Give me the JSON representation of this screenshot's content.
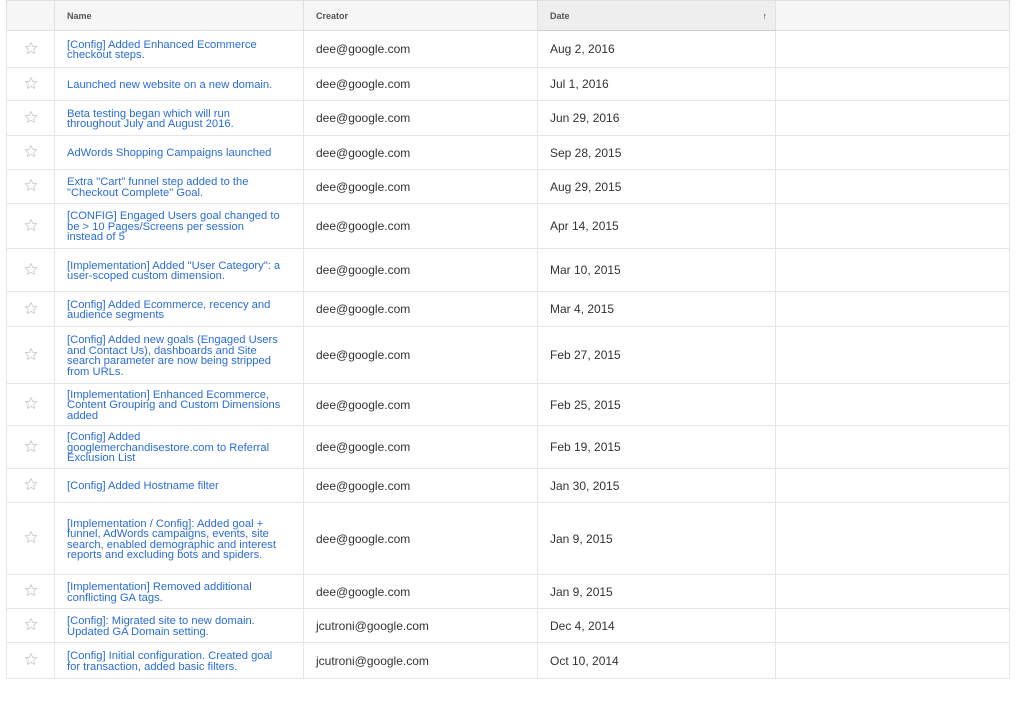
{
  "header": {
    "name_label": "Name",
    "creator_label": "Creator",
    "date_label": "Date",
    "sort_arrow": "↑"
  },
  "rows": [
    {
      "name": "[Config] Added Enhanced Ecommerce checkout steps.",
      "creator": "dee@google.com",
      "date": "Aug 2, 2016"
    },
    {
      "name": "Launched new website on a new domain.",
      "creator": "dee@google.com",
      "date": "Jul 1, 2016"
    },
    {
      "name": "Beta testing began which will run throughout July and August 2016.",
      "creator": "dee@google.com",
      "date": "Jun 29, 2016"
    },
    {
      "name": "AdWords Shopping Campaigns launched",
      "creator": "dee@google.com",
      "date": "Sep 28, 2015"
    },
    {
      "name": "Extra \"Cart\" funnel step added to the \"Checkout Complete\" Goal.",
      "creator": "dee@google.com",
      "date": "Aug 29, 2015"
    },
    {
      "name": "[CONFIG] Engaged Users goal changed to be > 10 Pages/Screens per session instead of 5",
      "creator": "dee@google.com",
      "date": "Apr 14, 2015"
    },
    {
      "name": "[Implementation] Added \"User Category\": a user-scoped custom dimension.",
      "creator": "dee@google.com",
      "date": "Mar 10, 2015"
    },
    {
      "name": "[Config] Added Ecommerce, recency and audience segments",
      "creator": "dee@google.com",
      "date": "Mar 4, 2015"
    },
    {
      "name": "[Config] Added new goals (Engaged Users and Contact Us), dashboards and Site search parameter are now being stripped from URLs.",
      "creator": "dee@google.com",
      "date": "Feb 27, 2015"
    },
    {
      "name": "[Implementation] Enhanced Ecommerce, Content Grouping and Custom Dimensions added",
      "creator": "dee@google.com",
      "date": "Feb 25, 2015"
    },
    {
      "name": "[Config] Added googlemerchandisestore.com to Referral Exclusion List",
      "creator": "dee@google.com",
      "date": "Feb 19, 2015"
    },
    {
      "name": "[Config] Added Hostname filter",
      "creator": "dee@google.com",
      "date": "Jan 30, 2015"
    },
    {
      "name": "[Implementation / Config]: Added goal + funnel, AdWords campaigns, events, site search, enabled demographic and interest reports and excluding bots and spiders.",
      "creator": "dee@google.com",
      "date": "Jan 9, 2015"
    },
    {
      "name": "[Implementation] Removed additional conflicting GA tags.",
      "creator": "dee@google.com",
      "date": "Jan 9, 2015"
    },
    {
      "name": "[Config]: Migrated site to new domain. Updated GA Domain setting.",
      "creator": "jcutroni@google.com",
      "date": "Dec 4, 2014"
    },
    {
      "name": "[Config] Initial configuration. Created goal for transaction, added basic filters.",
      "creator": "jcutroni@google.com",
      "date": "Oct 10, 2014"
    }
  ],
  "colors": {
    "link": "#2a6dd6",
    "star": "#c8c8c8",
    "header_bg": "#f6f6f6"
  },
  "icons": {
    "star": "star-outline-icon"
  }
}
